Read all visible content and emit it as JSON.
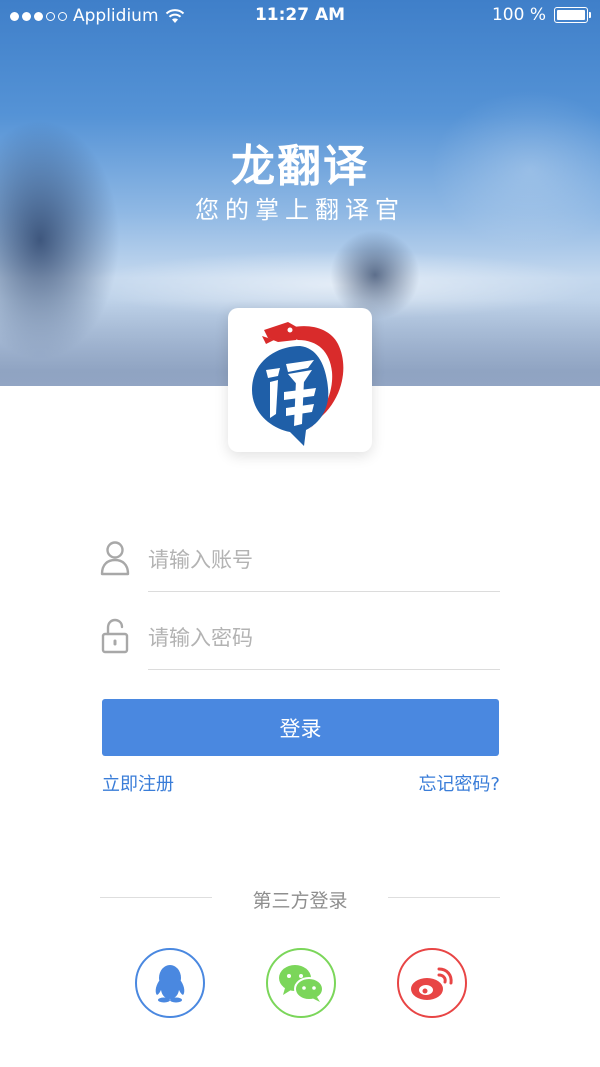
{
  "status_bar": {
    "carrier": "Applidium",
    "time": "11:27 AM",
    "battery": "100 %"
  },
  "header": {
    "title": "龙翻译",
    "subtitle": "您的掌上翻译官"
  },
  "form": {
    "account_placeholder": "请输入账号",
    "password_placeholder": "请输入密码",
    "login_label": "登录",
    "register_label": "立即注册",
    "forgot_label": "忘记密码?"
  },
  "third_party": {
    "label": "第三方登录",
    "providers": [
      "qq-icon",
      "wechat-icon",
      "weibo-icon"
    ]
  },
  "colors": {
    "accent": "#4a88e0",
    "link": "#3a7dd8",
    "qq": "#4a88e0",
    "wechat": "#7bd65a",
    "weibo": "#e84545",
    "logo_blue": "#1f5fa8",
    "logo_red": "#d92b2b"
  }
}
